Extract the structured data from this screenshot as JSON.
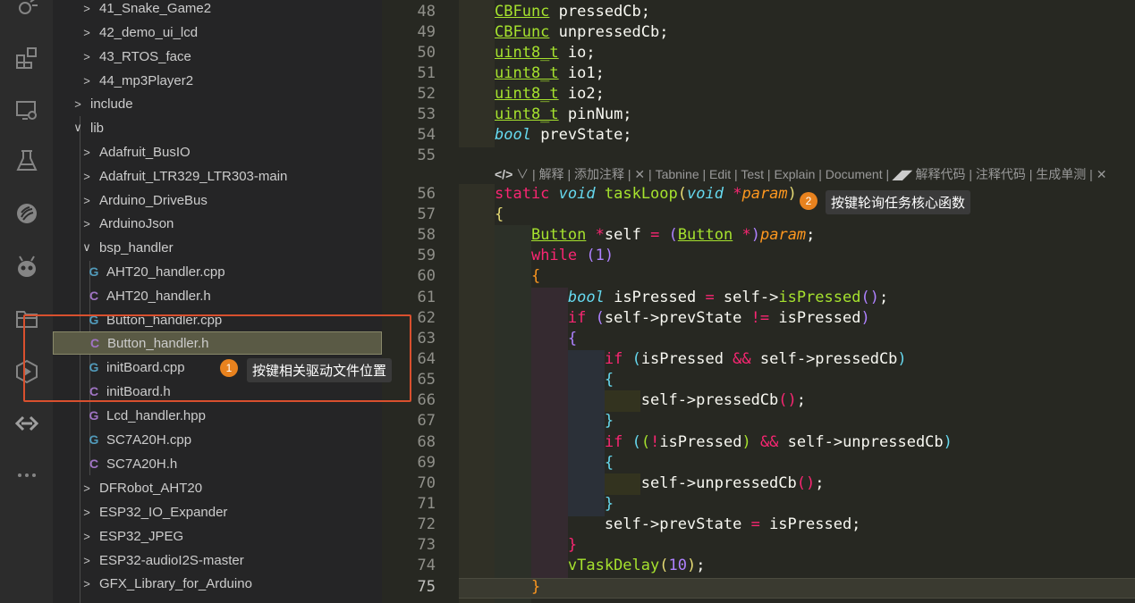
{
  "explorer": {
    "items": [
      {
        "label": "41_Snake_Game2",
        "kind": "folder-collapsed"
      },
      {
        "label": "42_demo_ui_lcd",
        "kind": "folder-collapsed"
      },
      {
        "label": "43_RTOS_face",
        "kind": "folder-collapsed"
      },
      {
        "label": "44_mp3Player2",
        "kind": "folder-collapsed"
      },
      {
        "label": "include",
        "kind": "folder-collapsed"
      },
      {
        "label": "lib",
        "kind": "folder-expanded"
      },
      {
        "label": "Adafruit_BusIO",
        "kind": "folder-collapsed"
      },
      {
        "label": "Adafruit_LTR329_LTR303-main",
        "kind": "folder-collapsed"
      },
      {
        "label": "Arduino_DriveBus",
        "kind": "folder-collapsed"
      },
      {
        "label": "ArduinoJson",
        "kind": "folder-collapsed"
      },
      {
        "label": "bsp_handler",
        "kind": "folder-expanded"
      },
      {
        "label": "AHT20_handler.cpp",
        "kind": "cpp"
      },
      {
        "label": "AHT20_handler.h",
        "kind": "h"
      },
      {
        "label": "Button_handler.cpp",
        "kind": "cpp"
      },
      {
        "label": "Button_handler.h",
        "kind": "h"
      },
      {
        "label": "initBoard.cpp",
        "kind": "cpp"
      },
      {
        "label": "initBoard.h",
        "kind": "h"
      },
      {
        "label": "Lcd_handler.hpp",
        "kind": "hpp"
      },
      {
        "label": "SC7A20H.cpp",
        "kind": "cpp"
      },
      {
        "label": "SC7A20H.h",
        "kind": "h"
      },
      {
        "label": "DFRobot_AHT20",
        "kind": "folder-collapsed"
      },
      {
        "label": "ESP32_IO_Expander",
        "kind": "folder-collapsed"
      },
      {
        "label": "ESP32_JPEG",
        "kind": "folder-collapsed"
      },
      {
        "label": "ESP32-audioI2S-master",
        "kind": "folder-collapsed"
      },
      {
        "label": "GFX_Library_for_Arduino",
        "kind": "folder-collapsed"
      }
    ],
    "selected_label": "Button_handler.h"
  },
  "activity_bar": {
    "icons": [
      "debug-icon",
      "extensions-icon",
      "remote-explorer-icon",
      "testing-icon",
      "platformio-icon",
      "alien-icon",
      "folder-icon",
      "media-icon",
      "tabnine-icon",
      "more-icon"
    ]
  },
  "annotations": {
    "badge1": "1",
    "callout1": "按键相关驱动文件位置",
    "badge2": "2",
    "callout2": "按键轮询任务核心函数"
  },
  "codelens": {
    "items": [
      "解释",
      "添加注释",
      "Tabnine",
      "Edit",
      "Test",
      "Explain",
      "Document",
      "解释代码",
      "注释代码",
      "生成单测"
    ]
  },
  "editor": {
    "line_numbers": [
      "48",
      "49",
      "50",
      "51",
      "52",
      "53",
      "54",
      "55",
      "",
      "56",
      "57",
      "58",
      "59",
      "60",
      "61",
      "62",
      "63",
      "64",
      "65",
      "66",
      "67",
      "68",
      "69",
      "70",
      "71",
      "72",
      "73",
      "74",
      "75"
    ],
    "active_line": "75"
  },
  "colors": {
    "accent_orange": "#e8821e",
    "annotation_red": "#d9502e",
    "editor_bg": "#272822"
  }
}
